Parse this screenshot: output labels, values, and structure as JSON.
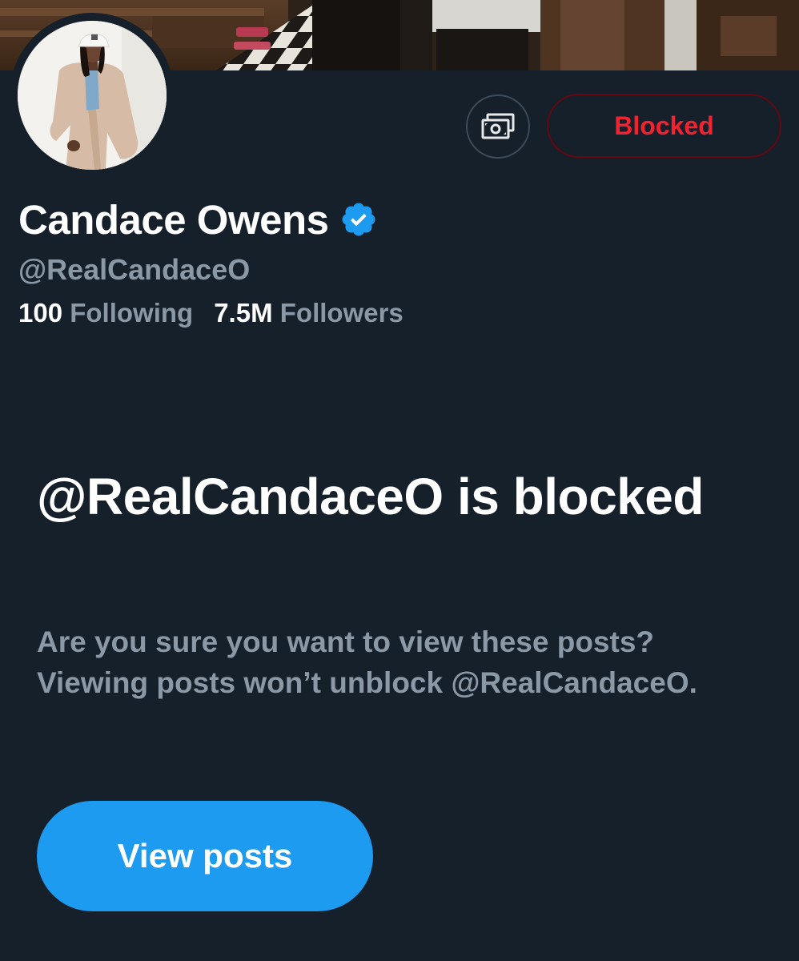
{
  "profile": {
    "display_name": "Candace Owens",
    "handle": "@RealCandaceO",
    "verified": true,
    "following_count": "100",
    "following_label": "Following",
    "followers_count": "7.5M",
    "followers_label": "Followers"
  },
  "actions": {
    "subscribe_icon": "money-icon",
    "blocked_label": "Blocked"
  },
  "notice": {
    "title": "@RealCandaceO is blocked",
    "body": "Are you sure you want to view these posts? Viewing posts won’t unblock @RealCandaceO.",
    "view_button_label": "View posts"
  },
  "colors": {
    "background": "#15202b",
    "accent": "#1d9bf0",
    "blocked_red": "#f4212e",
    "secondary_text": "#8b98a5"
  }
}
